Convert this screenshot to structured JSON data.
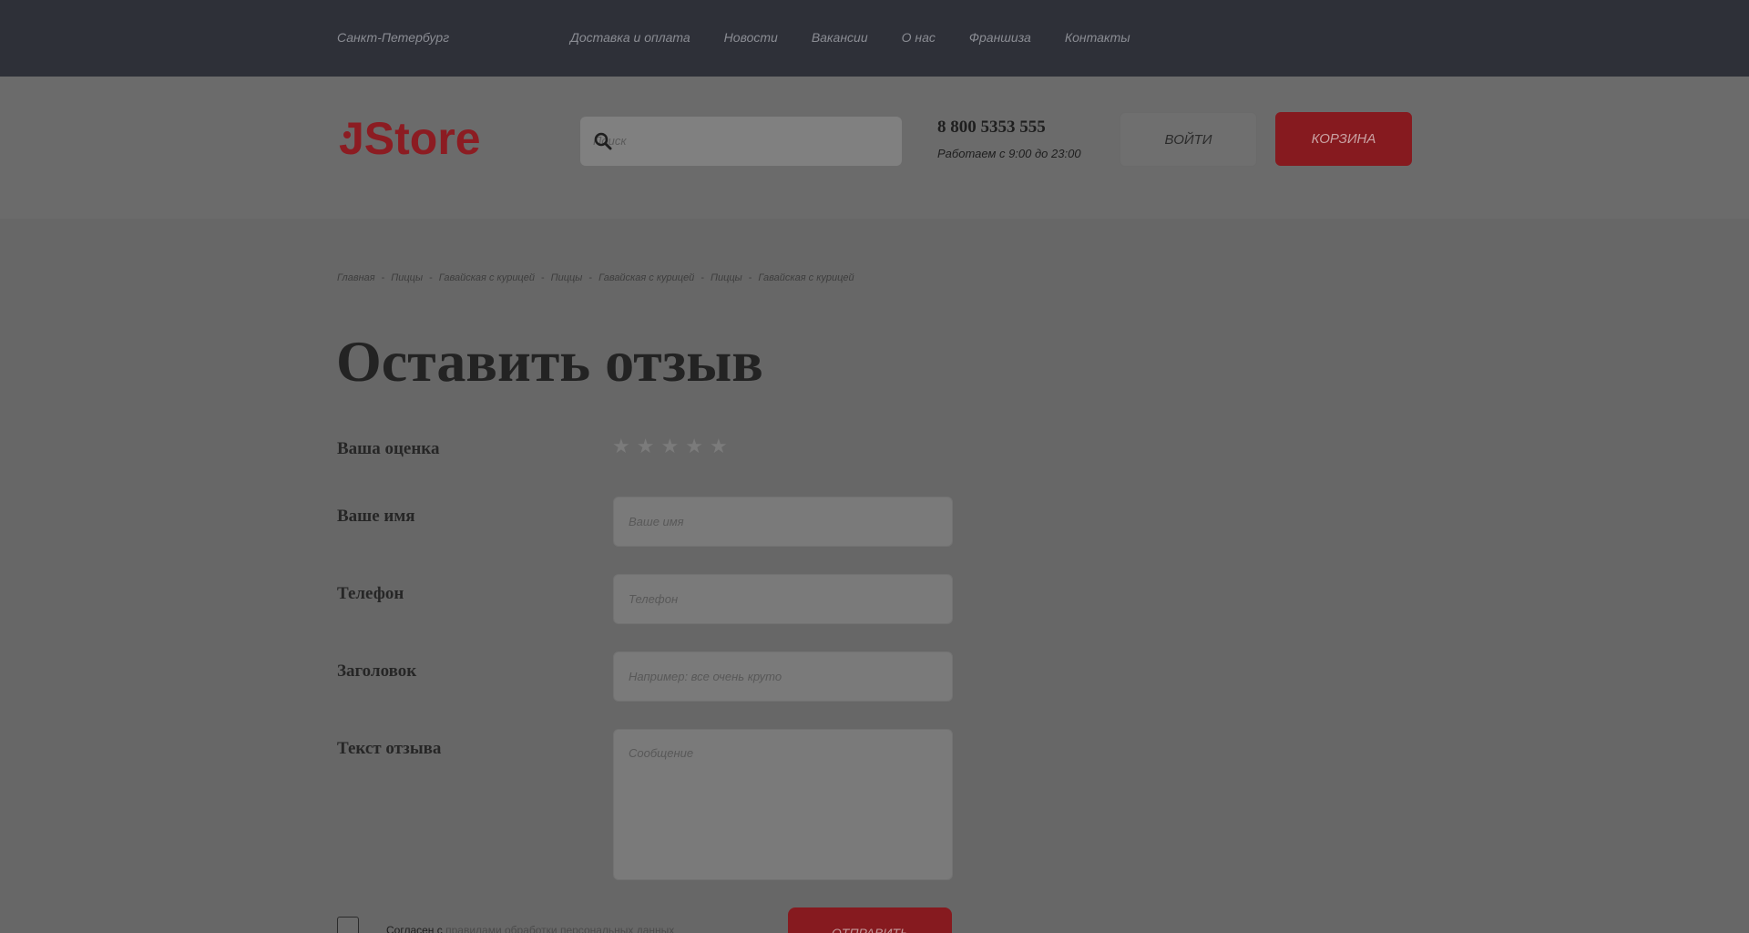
{
  "topbar": {
    "city": "Санкт-Петербург",
    "nav": [
      "Доставка и оплата",
      "Новости",
      "Вакансии",
      "О нас",
      "Франшиза",
      "Контакты"
    ]
  },
  "header": {
    "logo_text": "JStore",
    "search_placeholder": "Поиск",
    "phone": "8 800 5353 555",
    "hours": "Работаем с 9:00 до 23:00",
    "login_label": "ВОЙТИ",
    "cart_label": "КОРЗИНА"
  },
  "breadcrumb": [
    "Главная",
    "Пиццы",
    "Гавайская с курицей",
    "Пиццы",
    "Гавайская с курицей",
    "Пиццы",
    "Гавайская с курицей"
  ],
  "form": {
    "title": "Оставить отзыв",
    "rating_label": "Ваша оценка",
    "rating_stars": 5,
    "rating_value": 0,
    "name_label": "Ваше имя",
    "name_placeholder": "Ваше имя",
    "phone_label": "Телефон",
    "phone_placeholder": "Телефон",
    "subject_label": "Заголовок",
    "subject_placeholder": "Например: все очень круто",
    "text_label": "Текст отзыва",
    "text_placeholder": "Сообщение",
    "consent_prefix": "Согласен с",
    "consent_link": "правилами обработки персональных данных",
    "submit_label": "ОТПРАВИТЬ"
  },
  "colors": {
    "accent": "#861a1f",
    "logo_red": "#8c1c22",
    "topbar_bg": "#2e3038"
  },
  "icons": {
    "search": "search-icon",
    "star": "star-icon"
  }
}
